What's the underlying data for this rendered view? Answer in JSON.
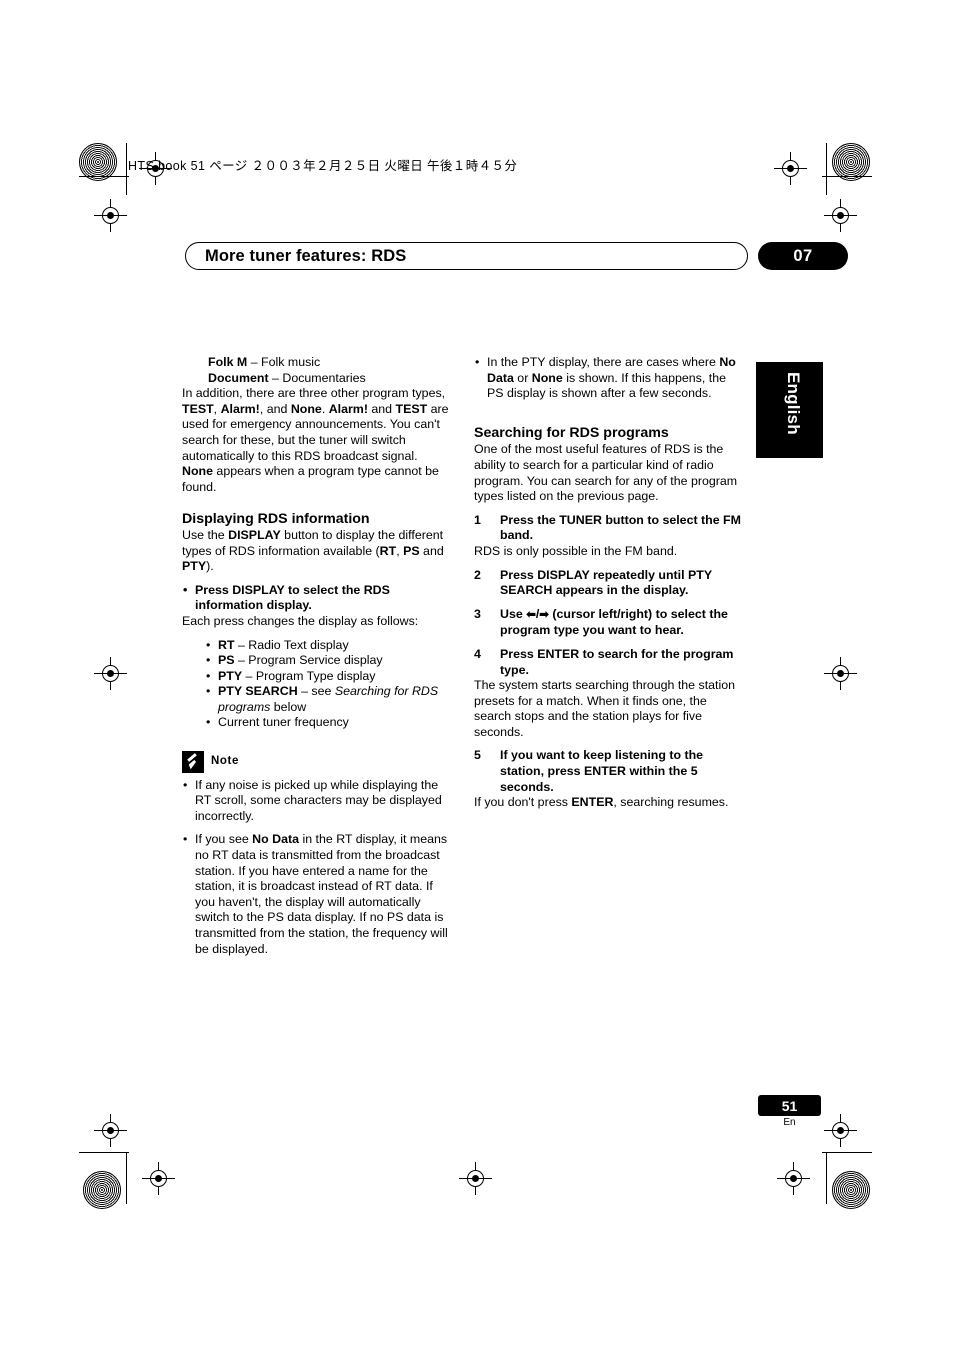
{
  "header": {
    "file_line": "HTS.book 51 ページ ２００３年２月２５日  火曜日  午後１時４５分"
  },
  "chapter": {
    "title": "More tuner features: RDS",
    "number": "07",
    "language_tab": "English"
  },
  "left_column": {
    "folk_term": "Folk M",
    "folk_desc": " – Folk music",
    "document_term": "Document",
    "document_desc": " – Documentaries",
    "intro_para": "In addition, there are three other program types, TEST, Alarm!, and None. Alarm! and TEST are used for emergency announcements. You can't search for these, but the tuner will switch automatically to this RDS broadcast signal. None appears when a program type cannot be found.",
    "section_display_title": "Displaying RDS information",
    "display_para": "Use the DISPLAY button to display the different types of RDS information available (RT, PS and PTY).",
    "display_bullet_bold": "Press DISPLAY to select the RDS information display.",
    "display_bullet_after": "Each press changes the display as follows:",
    "items": [
      {
        "term": "RT",
        "desc": " – Radio Text display"
      },
      {
        "term": "PS",
        "desc": " – Program Service display"
      },
      {
        "term": "PTY",
        "desc": " – Program Type display"
      },
      {
        "term": "PTY SEARCH",
        "desc": " – see Searching for RDS programs below"
      },
      {
        "term": "",
        "desc": "Current tuner frequency"
      }
    ],
    "note_label": "Note",
    "note_items": [
      "If any noise is picked up while displaying the RT scroll, some characters may be displayed incorrectly.",
      "If you see No Data in the RT display, it means no RT data is transmitted from the broadcast station. If you have entered a name for the station, it is broadcast instead of RT data. If you haven't, the display will automatically switch to the PS data display. If no PS data is transmitted from the station, the frequency will be displayed."
    ]
  },
  "right_column": {
    "top_bullet": "In the PTY display, there are cases where No Data or None is shown. If this happens, the PS display is shown after a few seconds.",
    "section_search_title": "Searching for RDS programs",
    "search_para": "One of the most useful features of RDS is the ability to search for a particular kind of radio program. You can search for any of the program types listed on the previous page.",
    "steps": [
      {
        "num": "1",
        "bold": "Press the TUNER button to select the FM band.",
        "body": "RDS is only possible in the FM band."
      },
      {
        "num": "2",
        "bold": "Press DISPLAY repeatedly until PTY SEARCH appears in the display.",
        "body": ""
      },
      {
        "num": "3",
        "bold": "Use ←/→ (cursor left/right) to select the program type you want to hear.",
        "body": ""
      },
      {
        "num": "4",
        "bold": "Press ENTER to search for the program type.",
        "body": "The system starts searching through the station presets for a match. When it finds one, the search stops and the station plays for five seconds."
      },
      {
        "num": "5",
        "bold": "If you want to keep listening to the station, press ENTER within the 5 seconds.",
        "body": "If you don't press ENTER, searching resumes."
      }
    ]
  },
  "footer": {
    "page_number": "51",
    "page_suffix": "En"
  }
}
